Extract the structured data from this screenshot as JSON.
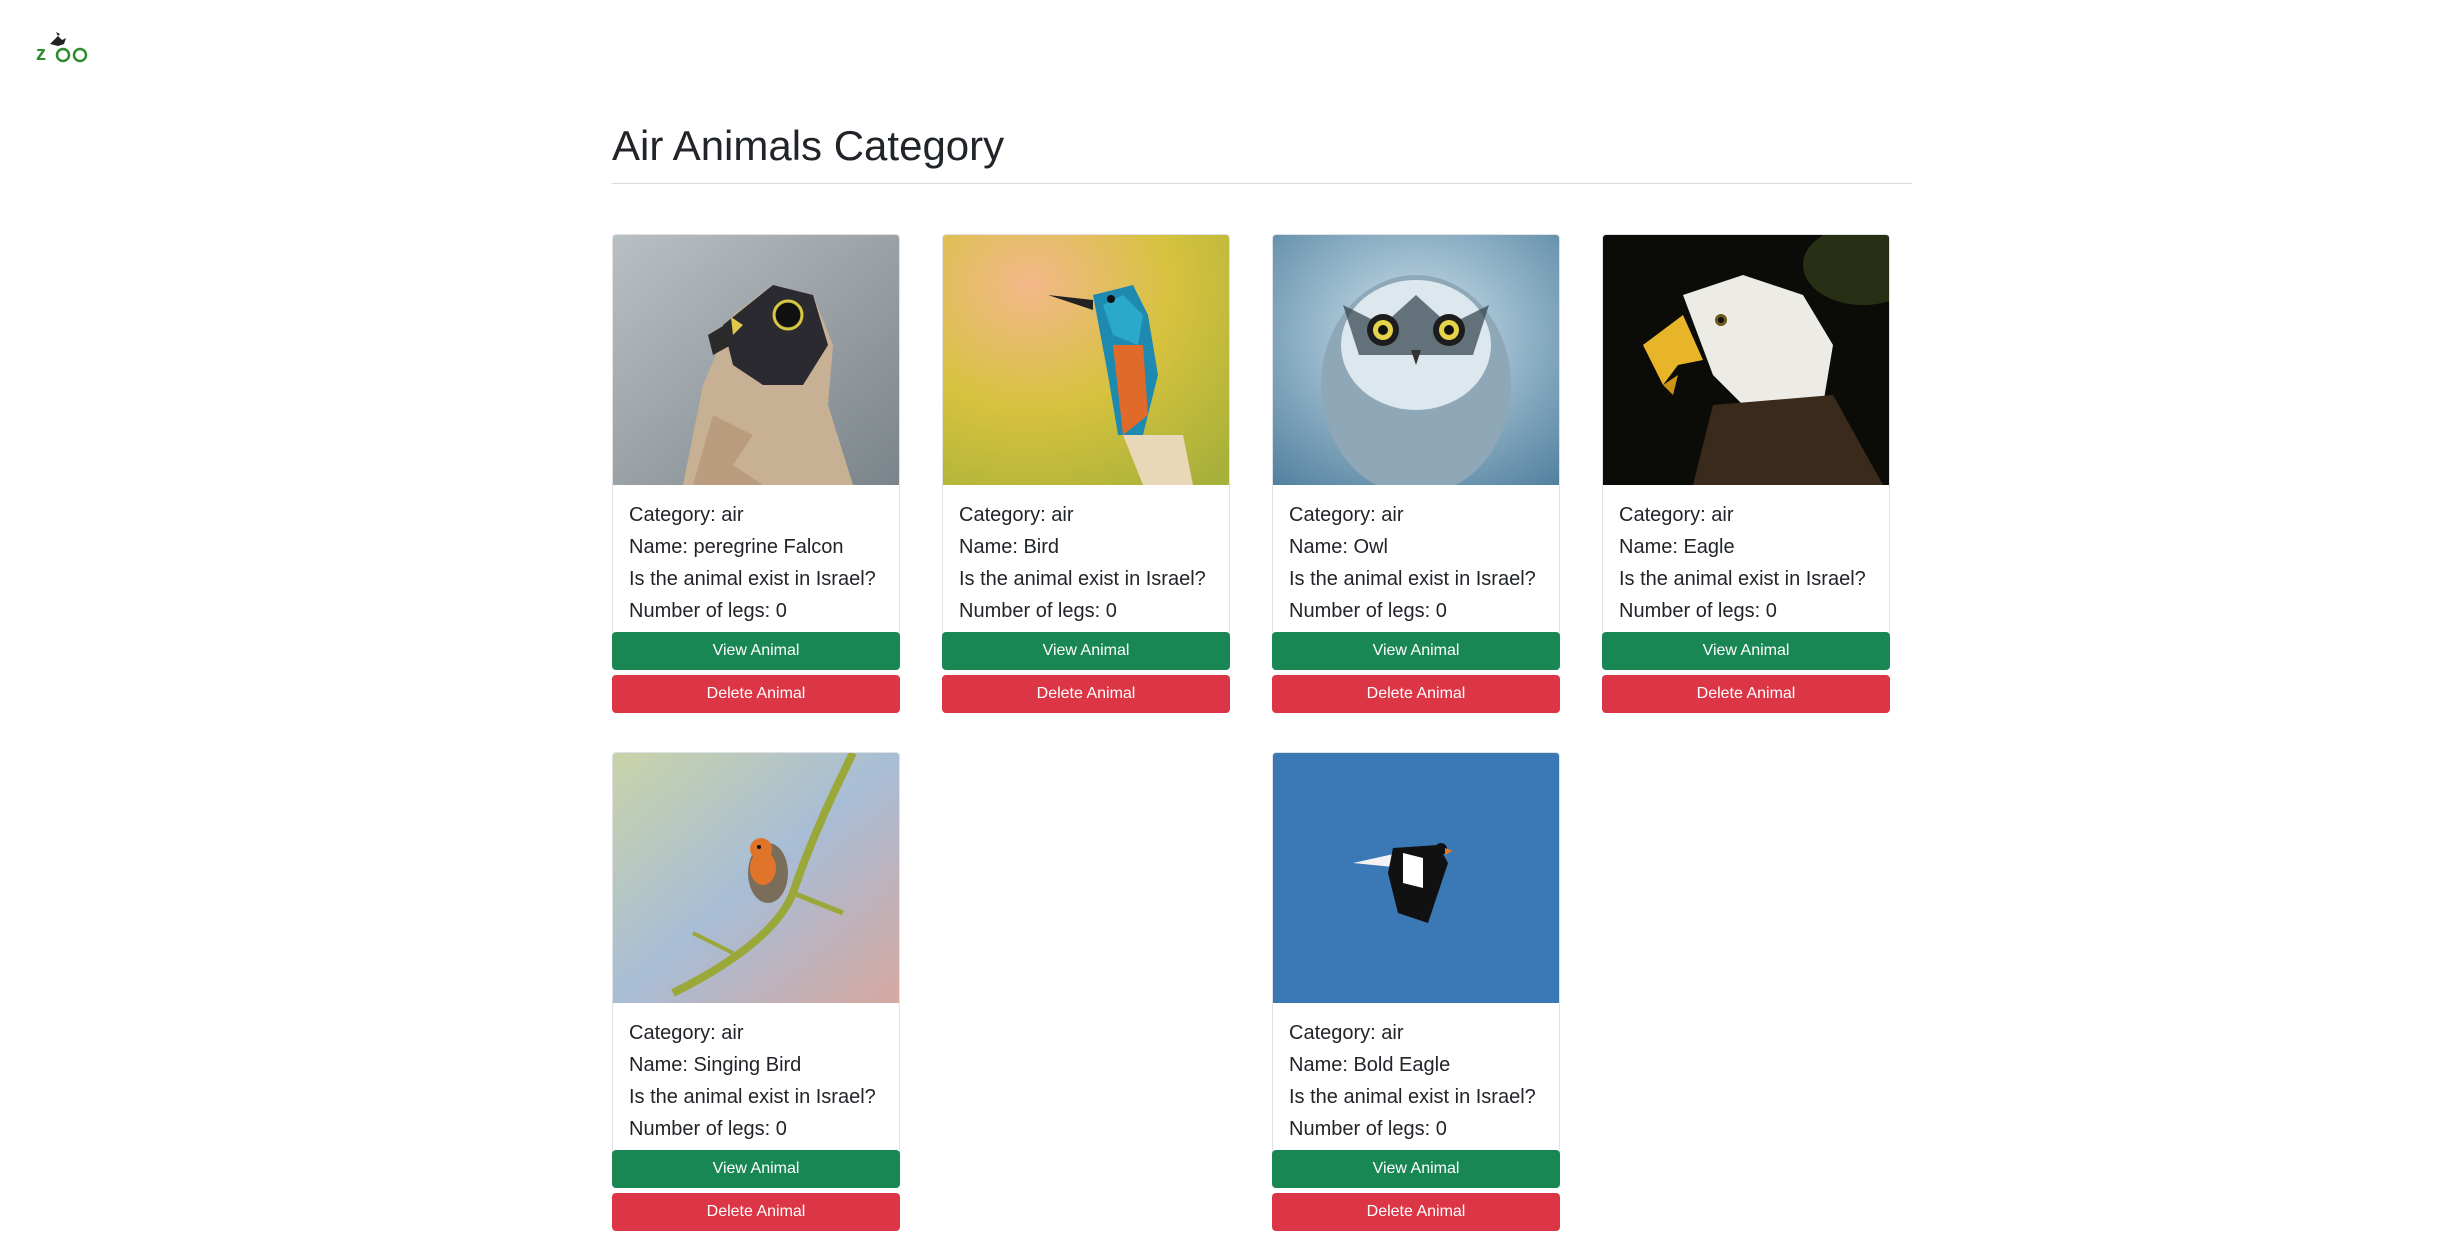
{
  "brand": {
    "logo_text": "zoo",
    "logo_color": "#2e8b2e"
  },
  "page": {
    "title": "Air Animals Category"
  },
  "colors": {
    "view_button": "#198754",
    "delete_button": "#dc3545"
  },
  "cards": [
    {
      "category": "Category: air",
      "name": "Name: peregrine Falcon",
      "exist": "Is the animal exist in Israel?",
      "legs": "Number of legs: 0",
      "view_label": "View Animal",
      "delete_label": "Delete Animal",
      "image": "falcon"
    },
    {
      "category": "Category: air",
      "name": "Name: Bird",
      "exist": "Is the animal exist in Israel?",
      "legs": "Number of legs: 0",
      "view_label": "View Animal",
      "delete_label": "Delete Animal",
      "image": "kingfisher"
    },
    {
      "category": "Category: air",
      "name": "Name: Owl",
      "exist": "Is the animal exist in Israel?",
      "legs": "Number of legs: 0",
      "view_label": "View Animal",
      "delete_label": "Delete Animal",
      "image": "owl"
    },
    {
      "category": "Category: air",
      "name": "Name: Eagle",
      "exist": "Is the animal exist in Israel?",
      "legs": "Number of legs: 0",
      "view_label": "View Animal",
      "delete_label": "Delete Animal",
      "image": "eagle"
    },
    {
      "category": "Category: air",
      "name": "Name: Singing Bird",
      "exist": "Is the animal exist in Israel?",
      "legs": "Number of legs: 0",
      "view_label": "View Animal",
      "delete_label": "Delete Animal",
      "image": "robin"
    },
    {
      "category": "Category: air",
      "name": "Name: Bold Eagle",
      "exist": "Is the animal exist in Israel?",
      "legs": "Number of legs: 0",
      "view_label": "View Animal",
      "delete_label": "Delete Animal",
      "image": "flying-bird"
    }
  ]
}
